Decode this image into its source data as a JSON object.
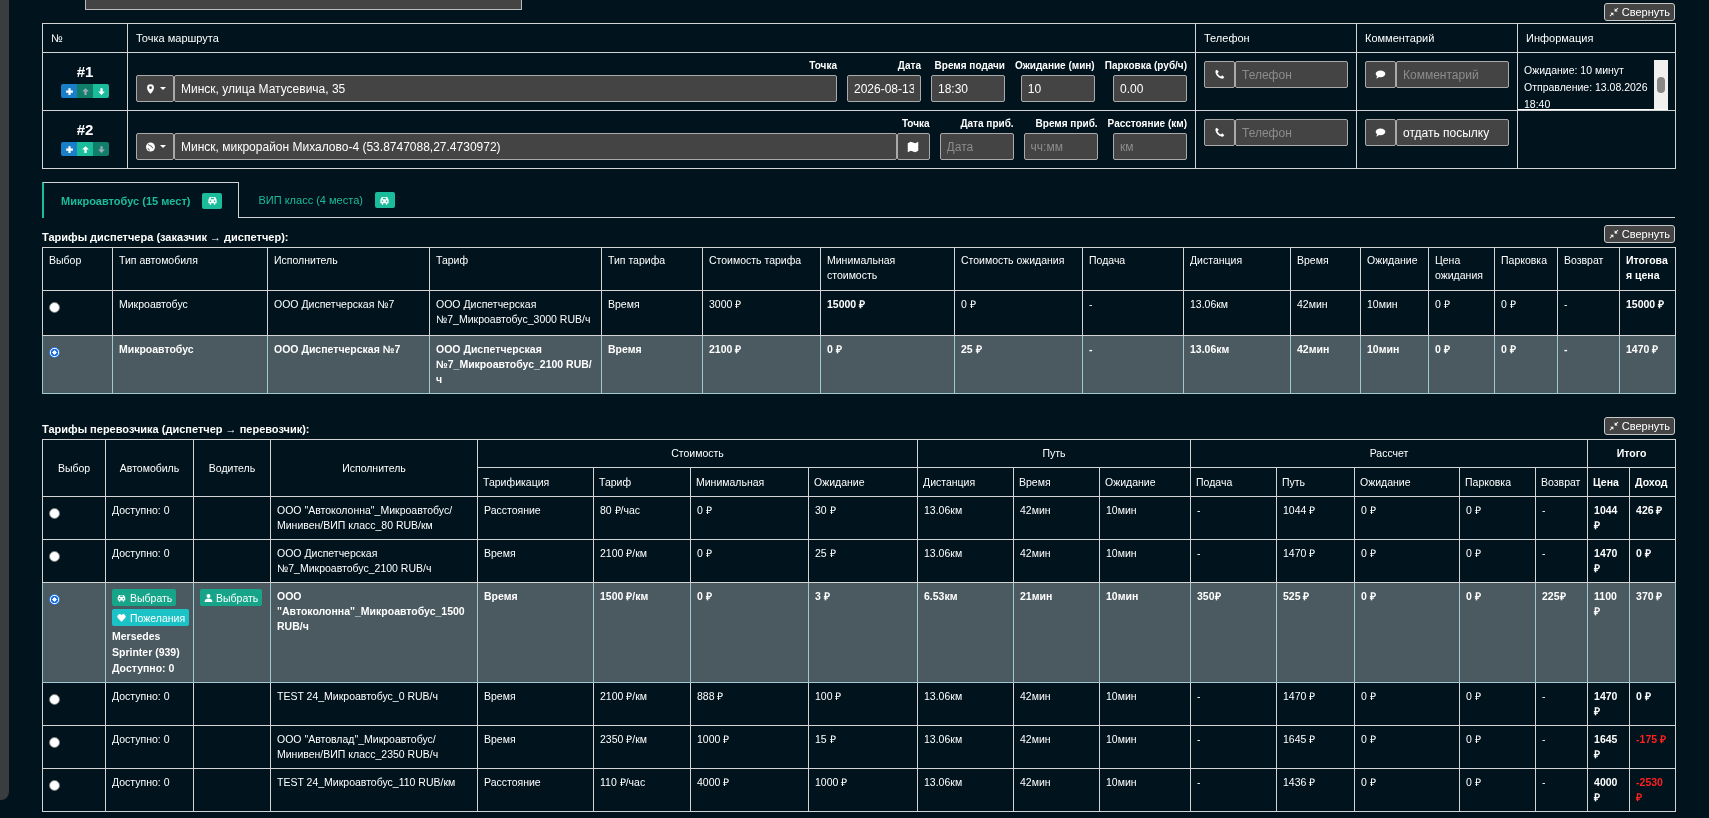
{
  "collapse_label_top": "Свернуть",
  "route": {
    "columns": [
      "№",
      "Точка маршрута",
      "Телефон",
      "Комментарий",
      "Информация"
    ],
    "points": [
      {
        "number": "#1",
        "kind": "street",
        "move_up_disabled": true,
        "move_down_disabled": false,
        "address_label": "Точка",
        "address": "Минск, улица Матусевича, 35",
        "fields": [
          {
            "label": "Дата",
            "value": "2026-08-13"
          },
          {
            "label": "Время подачи",
            "value": "18:30"
          },
          {
            "label": "Ожидание (мин)",
            "value": "10"
          },
          {
            "label": "Парковка (руб/ч)",
            "value": "0.00"
          }
        ],
        "phone": {
          "placeholder": "Телефон"
        },
        "comment": {
          "placeholder": "Комментарий"
        },
        "info": [
          "Ожидание: 10 минут",
          "Отправление: 13.08.2026 18:40"
        ]
      },
      {
        "number": "#2",
        "kind": "coordinates",
        "move_up_disabled": false,
        "move_down_disabled": true,
        "address_label": "Точка",
        "address": "Минск, микрорайон Михалово-4 (53.8747088,27.4730972)",
        "fields": [
          {
            "label": "Дата приб.",
            "placeholder": "Дата"
          },
          {
            "label": "Время приб.",
            "placeholder": "чч:мм"
          },
          {
            "label": "Расстояние (км)",
            "placeholder": "км"
          }
        ],
        "phone": {
          "placeholder": "Телефон"
        },
        "comment": {
          "value": "отдать посылку"
        }
      }
    ]
  },
  "tabs": [
    {
      "label": "Микроавтобус (15 мест)",
      "selected": true
    },
    {
      "label": "ВИП класс (4 места)",
      "selected": false
    }
  ],
  "dispatcher_tariffs": {
    "title": "Тарифы диспетчера (заказчик → диспетчер):",
    "collapse_label": "Свернуть",
    "columns": [
      {
        "label": "Выбор"
      },
      {
        "label": "Тип автомобиля"
      },
      {
        "label": "Исполнитель"
      },
      {
        "label": "Тариф"
      },
      {
        "label": "Тип тарифа"
      },
      {
        "label": "Стоимость тарифа"
      },
      {
        "label": "Минимальная стоимость",
        "bold_values": true
      },
      {
        "label": "Стоимость ожидания"
      },
      {
        "label": "Подача"
      },
      {
        "label": "Дистанция"
      },
      {
        "label": "Время"
      },
      {
        "label": "Ожидание"
      },
      {
        "label": "Цена ожидания"
      },
      {
        "label": "Парковка"
      },
      {
        "label": "Возврат"
      },
      {
        "label": "Итоговая цена",
        "bold_header": true,
        "bold_values": true
      }
    ],
    "rows": [
      {
        "selected": false,
        "cells": [
          "",
          "Микроавтобус",
          "ООО Диспетчерская №7",
          "ООО Диспетчерская №7_Микроавтобус_3000 RUB/ч",
          "Время",
          "3000 ₽",
          "15000 ₽",
          "0 ₽",
          "-",
          "13.06км",
          "42мин",
          "10мин",
          "0 ₽",
          "0 ₽",
          "-",
          "15000 ₽"
        ]
      },
      {
        "selected": true,
        "cells": [
          "",
          "Микроавтобус",
          "ООО Диспетчерская №7",
          "ООО Диспетчерская №7_Микроавтобус_2100 RUB/ч",
          "Время",
          "2100 ₽",
          "0 ₽",
          "25 ₽",
          "-",
          "13.06км",
          "42мин",
          "10мин",
          "0 ₽",
          "0 ₽",
          "-",
          "1470 ₽"
        ]
      }
    ]
  },
  "carrier_tariffs": {
    "title": "Тарифы перевозчика (диспетчер → перевозчик):",
    "collapse_label": "Свернуть",
    "columns": [
      {
        "label": "Выбор"
      },
      {
        "label": "Автомобиль"
      },
      {
        "label": "Водитель"
      },
      {
        "label": "Исполнитель"
      },
      {
        "label": "Стоимость",
        "colspan": 4,
        "children": [
          {
            "label": "Тарификация"
          },
          {
            "label": "Тариф"
          },
          {
            "label": "Минимальная"
          },
          {
            "label": "Ожидание"
          }
        ]
      },
      {
        "label": "Путь",
        "colspan": 3,
        "children": [
          {
            "label": "Дистанция"
          },
          {
            "label": "Время"
          },
          {
            "label": "Ожидание"
          }
        ]
      },
      {
        "label": "Рассчет",
        "colspan": 5,
        "children": [
          {
            "label": "Подача"
          },
          {
            "label": "Путь"
          },
          {
            "label": "Ожидание"
          },
          {
            "label": "Парковка"
          },
          {
            "label": "Возврат"
          }
        ]
      },
      {
        "label": "Итого",
        "bold_header": true,
        "bold_values": true,
        "colspan": 2,
        "children": [
          {
            "label": "Цена"
          },
          {
            "label": "Доход"
          }
        ]
      }
    ],
    "rows": [
      {
        "selected": false,
        "loss": false,
        "cells": [
          "",
          "Доступно: 0",
          "",
          "ООО \"Автоколонна\"_Микроавтобус/Минивен/ВИП класс_80 RUB/км",
          "Расстояние",
          "80 ₽/час",
          "0 ₽",
          "30 ₽",
          "13.06км",
          "42мин",
          "10мин",
          "-",
          "1044 ₽",
          "0 ₽",
          "0 ₽",
          "-",
          "1044 ₽",
          "426 ₽"
        ]
      },
      {
        "selected": false,
        "loss": false,
        "cells": [
          "",
          "Доступно: 0",
          "",
          "ООО Диспетчерская №7_Микроавтобус_2100 RUB/ч",
          "Время",
          "2100 ₽/км",
          "0 ₽",
          "25 ₽",
          "13.06км",
          "42мин",
          "10мин",
          "-",
          "1470 ₽",
          "0 ₽",
          "0 ₽",
          "-",
          "1470 ₽",
          "0 ₽"
        ]
      },
      {
        "selected": true,
        "loss": false,
        "vehicle_buttons": [
          {
            "label": "Выбрать",
            "kind": "car"
          },
          {
            "label": "Пожелания",
            "kind": "wishes"
          }
        ],
        "vehicle_name": "Mersedes Sprinter (939)",
        "driver_button": "Выбрать",
        "cells": [
          "",
          "Доступно: 0",
          "",
          "ООО \"Автоколонна\"_Микроавтобус_1500 RUB/ч",
          "Время",
          "1500 ₽/км",
          "0 ₽",
          "3 ₽",
          "6.53км",
          "21мин",
          "10мин",
          "350₽",
          "525 ₽",
          "0 ₽",
          "0 ₽",
          "225₽",
          "1100 ₽",
          "370 ₽"
        ]
      },
      {
        "selected": false,
        "loss": false,
        "cells": [
          "",
          "Доступно: 0",
          "",
          "TEST 24_Микроавтобус_0 RUB/ч",
          "Время",
          "2100 ₽/км",
          "888 ₽",
          "100 ₽",
          "13.06км",
          "42мин",
          "10мин",
          "-",
          "1470 ₽",
          "0 ₽",
          "0 ₽",
          "-",
          "1470 ₽",
          "0 ₽"
        ]
      },
      {
        "selected": false,
        "loss": true,
        "cells": [
          "",
          "Доступно: 0",
          "",
          "ООО \"Автовлад\"_Микроавтобус/Минивен/ВИП класс_2350 RUB/ч",
          "Время",
          "2350 ₽/км",
          "1000 ₽",
          "15 ₽",
          "13.06км",
          "42мин",
          "10мин",
          "-",
          "1645 ₽",
          "0 ₽",
          "0 ₽",
          "-",
          "1645 ₽",
          "-175 ₽"
        ]
      },
      {
        "selected": false,
        "loss": true,
        "cells": [
          "",
          "Доступно: 0",
          "",
          "TEST 24_Микроавтобус_110 RUB/км",
          "Расстояние",
          "110 ₽/час",
          "4000 ₽",
          "1000 ₽",
          "13.06км",
          "42мин",
          "10мин",
          "-",
          "1436 ₽",
          "0 ₽",
          "0 ₽",
          "-",
          "4000 ₽",
          "-2530 ₽"
        ]
      }
    ]
  }
}
